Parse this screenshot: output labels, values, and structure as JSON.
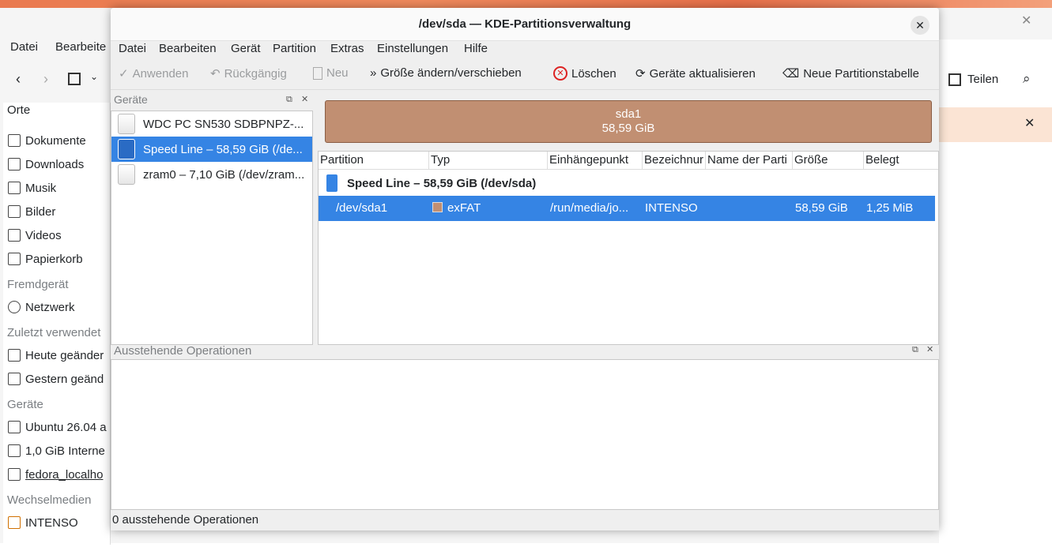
{
  "background_window": {
    "menu": [
      "Datei",
      "Bearbeite"
    ],
    "places_title": "Orte",
    "places": [
      "Dokumente",
      "Downloads",
      "Musik",
      "Bilder",
      "Videos",
      "Papierkorb"
    ],
    "remote_title": "Fremdgerät",
    "remote": [
      "Netzwerk"
    ],
    "recent_title": "Zuletzt verwendet",
    "recent": [
      "Heute geänder",
      "Gestern geänd"
    ],
    "devices_title": "Geräte",
    "devices": [
      "Ubuntu 26.04 a",
      "1,0 GiB Interne",
      "fedora_localho"
    ],
    "removable_title": "Wechselmedien",
    "removable": [
      "INTENSO"
    ],
    "share_label": "Teilen"
  },
  "window": {
    "title": "/dev/sda — KDE-Partitionsverwaltung",
    "menu": [
      "Datei",
      "Bearbeiten",
      "Gerät",
      "Partition",
      "Extras",
      "Einstellungen",
      "Hilfe"
    ],
    "toolbar": {
      "apply": "Anwenden",
      "undo": "Rückgängig",
      "new": "Neu",
      "resize": "Größe ändern/verschieben",
      "delete": "Löschen",
      "refresh": "Geräte aktualisieren",
      "new_table": "Neue Partitionstabelle"
    },
    "devices_header": "Geräte",
    "devices": [
      "WDC PC SN530 SDBPNPZ-...",
      "Speed Line – 58,59 GiB (/de...",
      "zram0 – 7,10 GiB (/dev/zram..."
    ],
    "partition_graphic": {
      "name": "sda1",
      "size": "58,59 GiB"
    },
    "table": {
      "columns": [
        "Partition",
        "Typ",
        "Einhängepunkt",
        "Bezeichnur",
        "Name der Parti",
        "Größe",
        "Belegt"
      ],
      "device_row": "Speed Line – 58,59 GiB (/dev/sda)",
      "rows": [
        {
          "partition": "/dev/sda1",
          "type": "exFAT",
          "mount": "/run/media/jo...",
          "label": "INTENSO",
          "name": "",
          "size": "58,59 GiB",
          "used": "1,25 MiB"
        }
      ]
    },
    "pending_header": "Ausstehende Operationen",
    "status": "0 ausstehende Operationen"
  },
  "colors": {
    "selection": "#3584e4",
    "exfat": "#c18f72"
  }
}
